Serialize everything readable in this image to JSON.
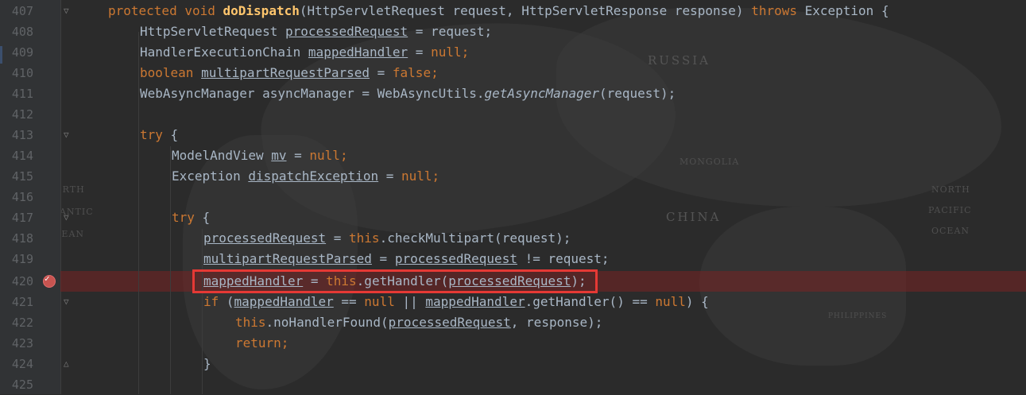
{
  "background_labels": {
    "russia": "RUSSIA",
    "mongolia": "MONGOLIA",
    "china": "CHINA",
    "north_atlantic": [
      "NORTH",
      "ATLANTIC",
      "OCEAN"
    ],
    "north_pacific": [
      "NORTH",
      "PACIFIC",
      "OCEAN"
    ],
    "philippines": "PHILIPPINES"
  },
  "lines": [
    {
      "num": "407"
    },
    {
      "num": "408"
    },
    {
      "num": "409"
    },
    {
      "num": "410"
    },
    {
      "num": "411"
    },
    {
      "num": "412"
    },
    {
      "num": "413"
    },
    {
      "num": "414"
    },
    {
      "num": "415"
    },
    {
      "num": "416"
    },
    {
      "num": "417"
    },
    {
      "num": "418"
    },
    {
      "num": "419"
    },
    {
      "num": "420"
    },
    {
      "num": "421"
    },
    {
      "num": "422"
    },
    {
      "num": "423"
    },
    {
      "num": "424"
    },
    {
      "num": "425"
    }
  ],
  "tokens": {
    "protected": "protected",
    "void": "void",
    "doDispatch": "doDispatch",
    "l407_params": "(HttpServletRequest request, HttpServletResponse response) ",
    "throws": "throws",
    "l407_tail": " Exception {",
    "HttpServletRequest": "HttpServletRequest ",
    "processedRequest": "processedRequest",
    "eq_request": " = request;",
    "HandlerExecutionChain": "HandlerExecutionChain ",
    "mappedHandler": "mappedHandler",
    "eq": " = ",
    "null": "null",
    "semicolon": ";",
    "boolean": "boolean",
    "multipartRequestParsed": "multipartRequestParsed",
    "false": "false",
    "l411_head": "WebAsyncManager asyncManager = WebAsyncUtils.",
    "getAsyncManager": "getAsyncManager",
    "l411_tail": "(request);",
    "try": "try",
    "brace_open": " {",
    "ModelAndView": "ModelAndView ",
    "mv": "mv",
    "Exception": "Exception ",
    "dispatchException": "dispatchException",
    "this": "this",
    "checkMultipart": ".checkMultipart(request);",
    "neq_request": " != request;",
    "getHandler_open": ".getHandler(",
    "paren_semi": ");",
    "if": "if",
    "l421_a": " (",
    "eqeq": " == ",
    "oror": " || ",
    "getHandler_call": ".getHandler() == ",
    "l421_tail": ") {",
    "noHandlerFound": ".noHandlerFound(",
    "l422_tail": ", response);",
    "return": "return",
    "brace_close": "}"
  }
}
